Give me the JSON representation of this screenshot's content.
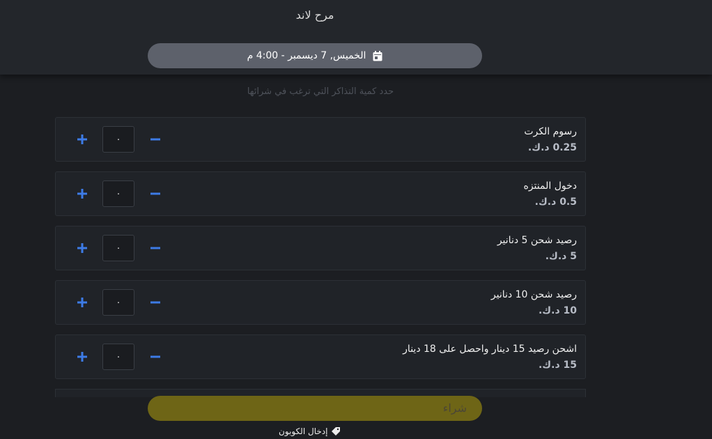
{
  "venue": "مرح لاند",
  "date_selector": {
    "label": "الخميس, 7 ديسمبر - 4:00 م",
    "icon": "calendar-icon"
  },
  "subtitle": "حدد كمية التذاكر التي ترغب في شرائها",
  "tickets": [
    {
      "name": "رسوم الكرت",
      "price": "0.25 د.ك.",
      "quantity": "٠"
    },
    {
      "name": "دخول المنتزه",
      "price": "0.5 د.ك.",
      "quantity": "٠"
    },
    {
      "name": "رصيد شحن 5 دنانير",
      "price": "5 د.ك.",
      "quantity": "٠"
    },
    {
      "name": "رصيد شحن 10 دنانير",
      "price": "10 د.ك.",
      "quantity": "٠"
    },
    {
      "name": "اشحن رصيد 15 دينار واحصل على 18 دينار",
      "price": "15 د.ك.",
      "quantity": "٠"
    }
  ],
  "buy_button": {
    "label": "شراء"
  },
  "coupon": {
    "label": "إدخال الكوبون",
    "icon": "tag-icon"
  },
  "colors": {
    "background": "#1c1e22",
    "header": "#23262b",
    "pill": "#5d616b",
    "accent_blue": "#3d7be6",
    "buy_button": "#6e6516"
  }
}
